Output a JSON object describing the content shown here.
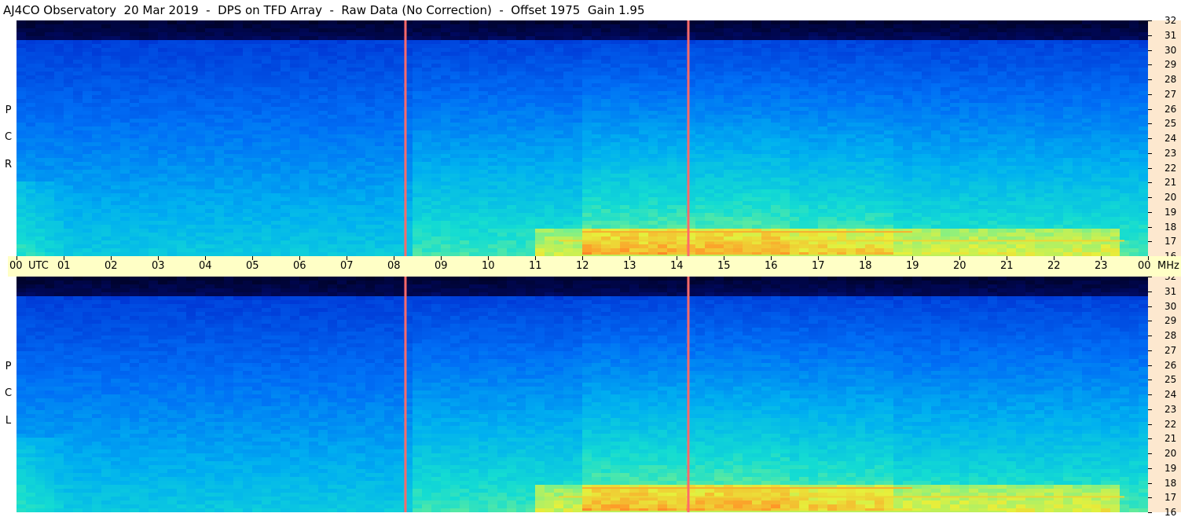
{
  "title": "AJ4CO Observatory  20 Mar 2019  -  DPS on TFD Array  -  Raw Data (No Correction)  -  Offset 1975  Gain 1.95",
  "panels": [
    {
      "label": "R C P",
      "letters": [
        "P",
        "C",
        "R"
      ]
    },
    {
      "label": "L C P",
      "letters": [
        "P",
        "C",
        "L"
      ]
    }
  ],
  "colors": {
    "background": "#ffffff",
    "time_axis_band": "#ffffc6",
    "freq_axis_band": "#fde8cf",
    "spectrogram_low": "#000012",
    "spectrogram_high": "#ff2a2a",
    "marker_line": "#ff6a6a"
  },
  "chart_data": [
    {
      "type": "heatmap",
      "name": "RCP spectrogram",
      "x_axis": {
        "unit": "UTC",
        "range_hours": [
          0,
          24
        ],
        "tick_labels": [
          "00",
          "01",
          "02",
          "03",
          "04",
          "05",
          "06",
          "07",
          "08",
          "09",
          "10",
          "11",
          "12",
          "13",
          "14",
          "15",
          "16",
          "17",
          "18",
          "19",
          "20",
          "21",
          "22",
          "23",
          "00"
        ]
      },
      "y_axis": {
        "unit": "MHz",
        "range": [
          16,
          32
        ],
        "tick_labels": [
          "32",
          "31",
          "30",
          "29",
          "28",
          "27",
          "26",
          "25",
          "24",
          "23",
          "22",
          "21",
          "20",
          "19",
          "18",
          "17",
          "16"
        ]
      },
      "vertical_markers_utc": [
        8.25,
        14.25
      ],
      "grid": false
    },
    {
      "type": "heatmap",
      "name": "LCP spectrogram",
      "x_axis": {
        "unit": "UTC",
        "range_hours": [
          0,
          24
        ],
        "tick_labels": [
          "00",
          "01",
          "02",
          "03",
          "04",
          "05",
          "06",
          "07",
          "08",
          "09",
          "10",
          "11",
          "12",
          "13",
          "14",
          "15",
          "16",
          "17",
          "18",
          "19",
          "20",
          "21",
          "22",
          "23",
          "00"
        ]
      },
      "y_axis": {
        "unit": "MHz",
        "range": [
          16,
          32
        ],
        "tick_labels": [
          "32",
          "31",
          "30",
          "29",
          "28",
          "27",
          "26",
          "25",
          "24",
          "23",
          "22",
          "21",
          "20",
          "19",
          "18",
          "17",
          "16"
        ]
      },
      "vertical_markers_utc": [
        8.25,
        14.25
      ],
      "grid": false
    }
  ],
  "axis_text": {
    "utc": "UTC",
    "mhz": "MHz"
  }
}
